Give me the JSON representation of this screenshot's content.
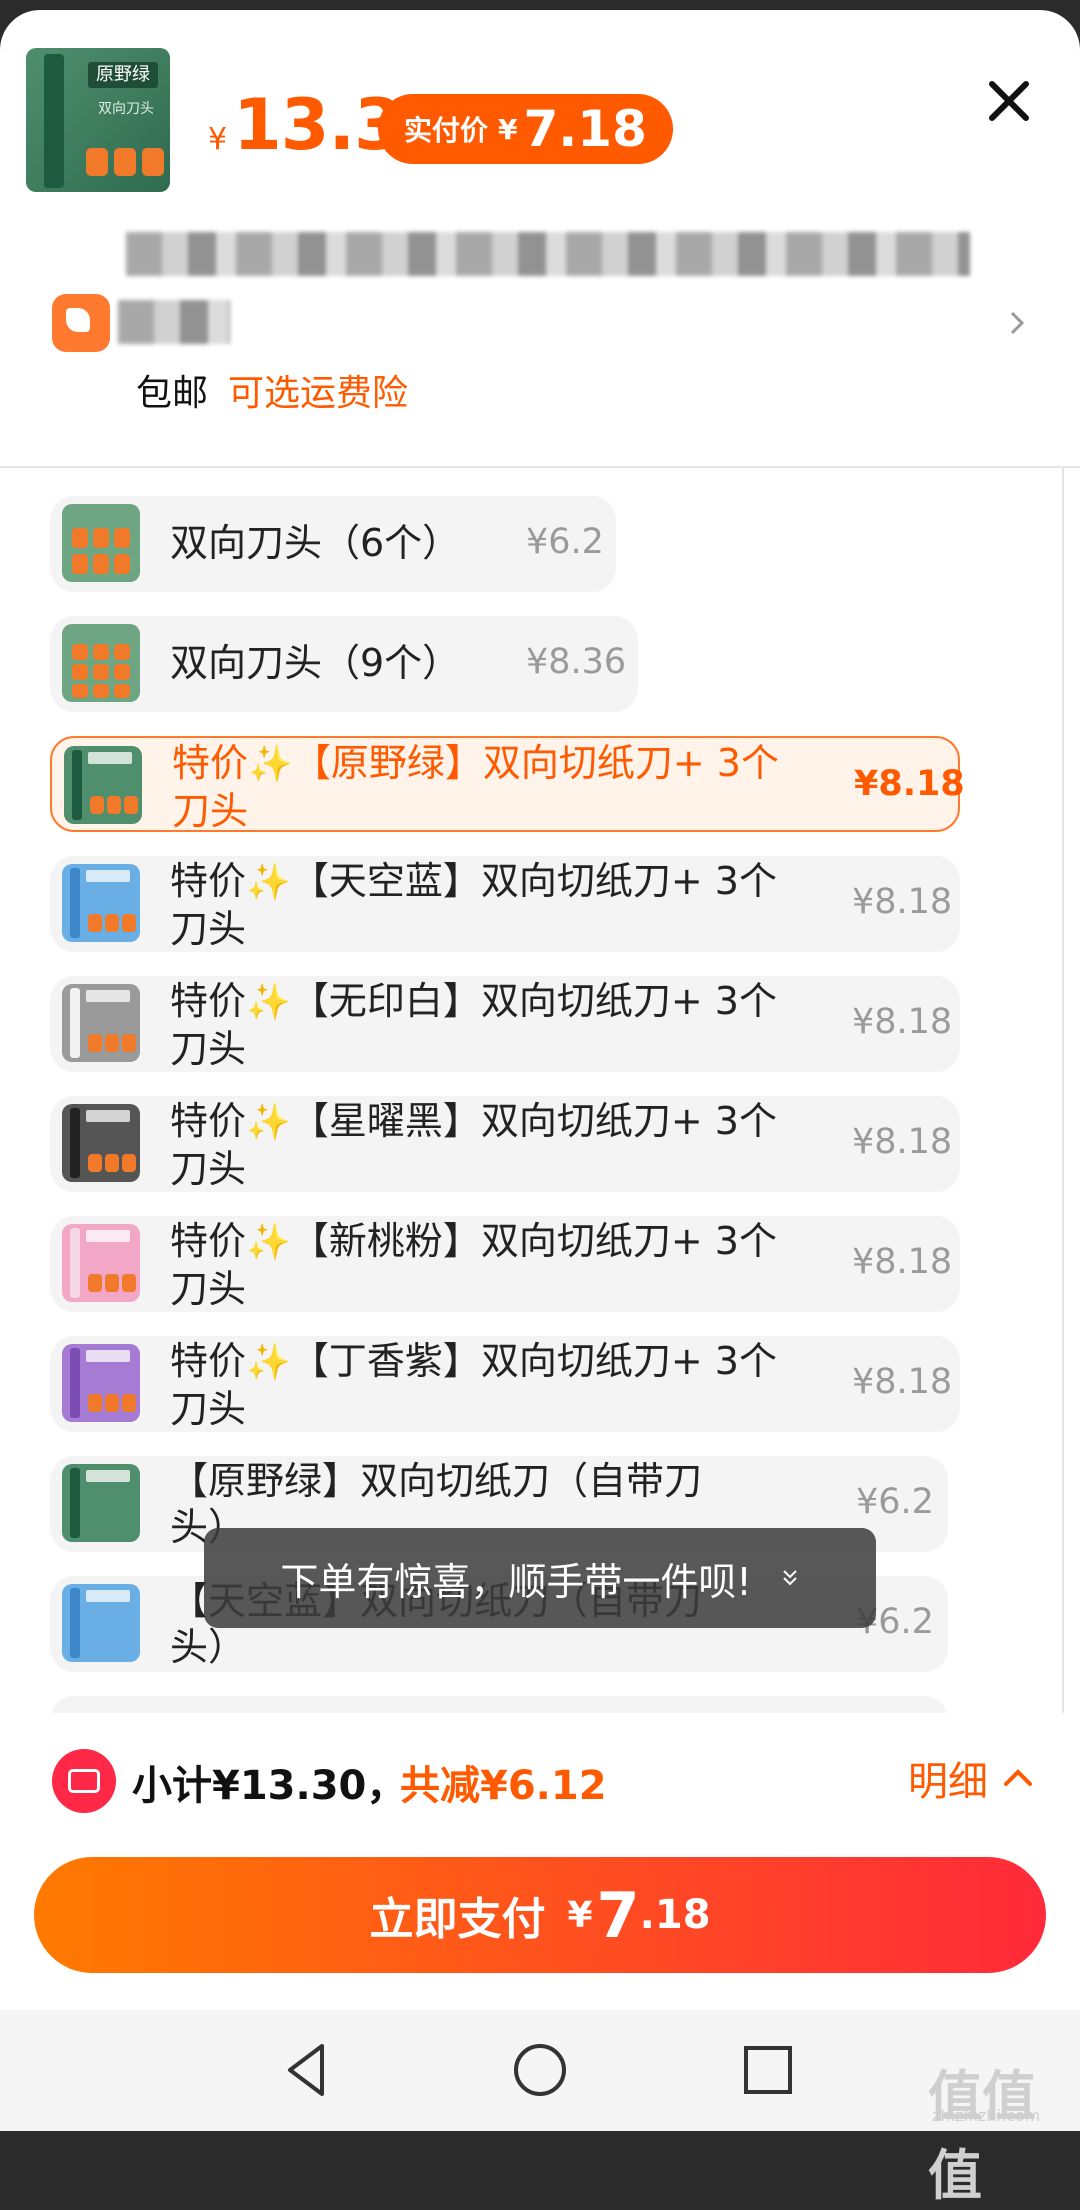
{
  "header": {
    "price_currency": "¥",
    "price": "13.3",
    "pay_label": "实付价",
    "pay_currency": "¥",
    "pay_price": "7.18",
    "shipping": "包邮",
    "shipping_insurance": "可选运费险"
  },
  "skus": [
    {
      "name": "双向刀头（6个）",
      "price": "¥6.2",
      "theme": "#6ea583",
      "selected": false
    },
    {
      "name": "双向刀头（9个）",
      "price": "¥8.36",
      "theme": "#6ea583",
      "selected": false
    },
    {
      "name_pre": "特价",
      "spark": "✨",
      "name_post": "【原野绿】双向切纸刀+ 3个刀头",
      "price": "¥8.18",
      "theme": "#4f8f6e",
      "selected": true
    },
    {
      "name_pre": "特价",
      "spark": "✨",
      "name_post": "【天空蓝】双向切纸刀+ 3个刀头",
      "price": "¥8.18",
      "theme": "#6aaee6",
      "selected": false
    },
    {
      "name_pre": "特价",
      "spark": "✨",
      "name_post": "【无印白】双向切纸刀+ 3个刀头",
      "price": "¥8.18",
      "theme": "#9a9a9a",
      "selected": false
    },
    {
      "name_pre": "特价",
      "spark": "✨",
      "name_post": "【星曜黑】双向切纸刀+ 3个刀头",
      "price": "¥8.18",
      "theme": "#555555",
      "selected": false
    },
    {
      "name_pre": "特价",
      "spark": "✨",
      "name_post": "【新桃粉】双向切纸刀+ 3个刀头",
      "price": "¥8.18",
      "theme": "#f3a7c6",
      "selected": false
    },
    {
      "name_pre": "特价",
      "spark": "✨",
      "name_post": "【丁香紫】双向切纸刀+ 3个刀头",
      "price": "¥8.18",
      "theme": "#a57bd3",
      "selected": false
    },
    {
      "name": "【原野绿】双向切纸刀（自带刀头）",
      "price": "¥6.2",
      "theme": "#4f8f6e",
      "selected": false
    },
    {
      "name": "【天空蓝】双向切纸刀（自带刀头）",
      "price": "¥6.2",
      "theme": "#6aaee6",
      "selected": false
    }
  ],
  "toast": {
    "text": "下单有惊喜，顺手带一件呗!"
  },
  "footer": {
    "subtotal": "小计¥13.30，",
    "discount": "共减¥6.12",
    "detail": "明细",
    "pay_label": "立即支付",
    "pay_currency": "¥",
    "pay_int": "7",
    "pay_dec": ".18"
  },
  "watermark": {
    "logo": "值值值",
    "site": "zhizhizhi.com"
  },
  "colors": {
    "accent": "#ff5a00",
    "pay_gradient_start": "#ff7a00",
    "pay_gradient_end": "#ff2a3a"
  }
}
